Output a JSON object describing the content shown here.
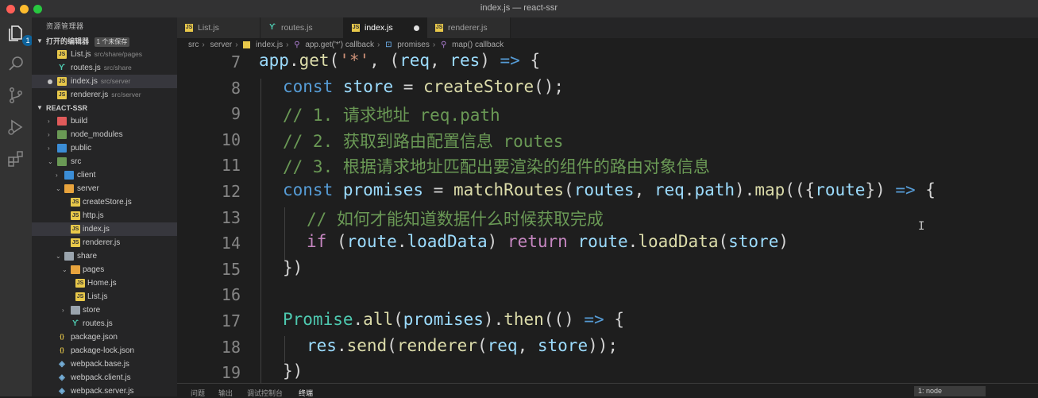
{
  "window": {
    "title": "index.js — react-ssr"
  },
  "activity_bar": {
    "explorer_badge": "1"
  },
  "sidebar": {
    "header": "资源管理器",
    "open_editors": {
      "label": "打开的编辑器",
      "badge": "1 个未保存"
    },
    "open_files": [
      {
        "name": "List.js",
        "path": "src/share/pages"
      },
      {
        "name": "routes.js",
        "path": "src/share"
      },
      {
        "name": "index.js",
        "path": "src/server"
      },
      {
        "name": "renderer.js",
        "path": "src/server"
      }
    ],
    "project": {
      "label": "REACT-SSR"
    },
    "tree": [
      {
        "name": "build"
      },
      {
        "name": "node_modules"
      },
      {
        "name": "public"
      },
      {
        "name": "src"
      },
      {
        "name": "client"
      },
      {
        "name": "server"
      },
      {
        "name": "createStore.js"
      },
      {
        "name": "http.js"
      },
      {
        "name": "index.js"
      },
      {
        "name": "renderer.js"
      },
      {
        "name": "share"
      },
      {
        "name": "pages"
      },
      {
        "name": "Home.js"
      },
      {
        "name": "List.js"
      },
      {
        "name": "store"
      },
      {
        "name": "routes.js"
      },
      {
        "name": "package.json"
      },
      {
        "name": "package-lock.json"
      },
      {
        "name": "webpack.base.js"
      },
      {
        "name": "webpack.client.js"
      },
      {
        "name": "webpack.server.js"
      }
    ]
  },
  "tabs": [
    {
      "label": "List.js"
    },
    {
      "label": "routes.js"
    },
    {
      "label": "index.js"
    },
    {
      "label": "renderer.js"
    }
  ],
  "breadcrumbs": [
    "src",
    "server",
    "index.js",
    "app.get('*') callback",
    "promises",
    "map() callback"
  ],
  "editor": {
    "line_numbers": [
      "7",
      "8",
      "9",
      "10",
      "11",
      "12",
      "13",
      "14",
      "15",
      "16",
      "17",
      "18",
      "19"
    ],
    "lines": [
      {
        "t": [
          [
            "app",
            "var"
          ],
          [
            ".",
            "op"
          ],
          [
            "get",
            "fn"
          ],
          [
            "(",
            "op"
          ],
          [
            "'*'",
            "str"
          ],
          [
            ", (",
            "op"
          ],
          [
            "req",
            "var"
          ],
          [
            ", ",
            "op"
          ],
          [
            "res",
            "var"
          ],
          [
            ") ",
            "op"
          ],
          [
            "=>",
            "k-blue"
          ],
          [
            " {",
            "op"
          ]
        ]
      },
      {
        "t": [
          [
            "const",
            "k-blue"
          ],
          [
            " ",
            "op"
          ],
          [
            "store",
            "var"
          ],
          [
            " = ",
            "op"
          ],
          [
            "createStore",
            "fn"
          ],
          [
            "();",
            "op"
          ]
        ]
      },
      {
        "t": [
          [
            "// 1. 请求地址 req.path",
            "cmt"
          ]
        ]
      },
      {
        "t": [
          [
            "// 2. 获取到路由配置信息 routes",
            "cmt"
          ]
        ]
      },
      {
        "t": [
          [
            "// 3. 根据请求地址匹配出要渲染的组件的路由对象信息",
            "cmt"
          ]
        ]
      },
      {
        "t": [
          [
            "const",
            "k-blue"
          ],
          [
            " ",
            "op"
          ],
          [
            "promises",
            "var"
          ],
          [
            " = ",
            "op"
          ],
          [
            "matchRoutes",
            "fn"
          ],
          [
            "(",
            "op"
          ],
          [
            "routes",
            "var"
          ],
          [
            ", ",
            "op"
          ],
          [
            "req",
            "var"
          ],
          [
            ".",
            "op"
          ],
          [
            "path",
            "var"
          ],
          [
            ").",
            "op"
          ],
          [
            "map",
            "fn"
          ],
          [
            "(({",
            "op"
          ],
          [
            "route",
            "var"
          ],
          [
            "}) ",
            "op"
          ],
          [
            "=>",
            "k-blue"
          ],
          [
            " {",
            "op"
          ]
        ]
      },
      {
        "t": [
          [
            "// 如何才能知道数据什么时候获取完成",
            "cmt"
          ]
        ]
      },
      {
        "t": [
          [
            "if",
            "k-purple"
          ],
          [
            " (",
            "op"
          ],
          [
            "route",
            "var"
          ],
          [
            ".",
            "op"
          ],
          [
            "loadData",
            "var"
          ],
          [
            ") ",
            "op"
          ],
          [
            "return",
            "k-purple"
          ],
          [
            " ",
            "op"
          ],
          [
            "route",
            "var"
          ],
          [
            ".",
            "op"
          ],
          [
            "loadData",
            "fn"
          ],
          [
            "(",
            "op"
          ],
          [
            "store",
            "var"
          ],
          [
            ")",
            "op"
          ]
        ]
      },
      {
        "t": [
          [
            "})",
            "op"
          ]
        ]
      },
      {
        "t": []
      },
      {
        "t": [
          [
            "Promise",
            "cls"
          ],
          [
            ".",
            "op"
          ],
          [
            "all",
            "fn"
          ],
          [
            "(",
            "op"
          ],
          [
            "promises",
            "var"
          ],
          [
            ").",
            "op"
          ],
          [
            "then",
            "fn"
          ],
          [
            "(() ",
            "op"
          ],
          [
            "=>",
            "k-blue"
          ],
          [
            " {",
            "op"
          ]
        ]
      },
      {
        "t": [
          [
            "res",
            "var"
          ],
          [
            ".",
            "op"
          ],
          [
            "send",
            "fn"
          ],
          [
            "(",
            "op"
          ],
          [
            "renderer",
            "fn"
          ],
          [
            "(",
            "op"
          ],
          [
            "req",
            "var"
          ],
          [
            ", ",
            "op"
          ],
          [
            "store",
            "var"
          ],
          [
            "));",
            "op"
          ]
        ]
      },
      {
        "t": [
          [
            "})",
            "op"
          ]
        ]
      }
    ]
  },
  "panel": {
    "tabs": [
      "问题",
      "输出",
      "调试控制台",
      "终端"
    ],
    "terminal_select": "1: node"
  }
}
